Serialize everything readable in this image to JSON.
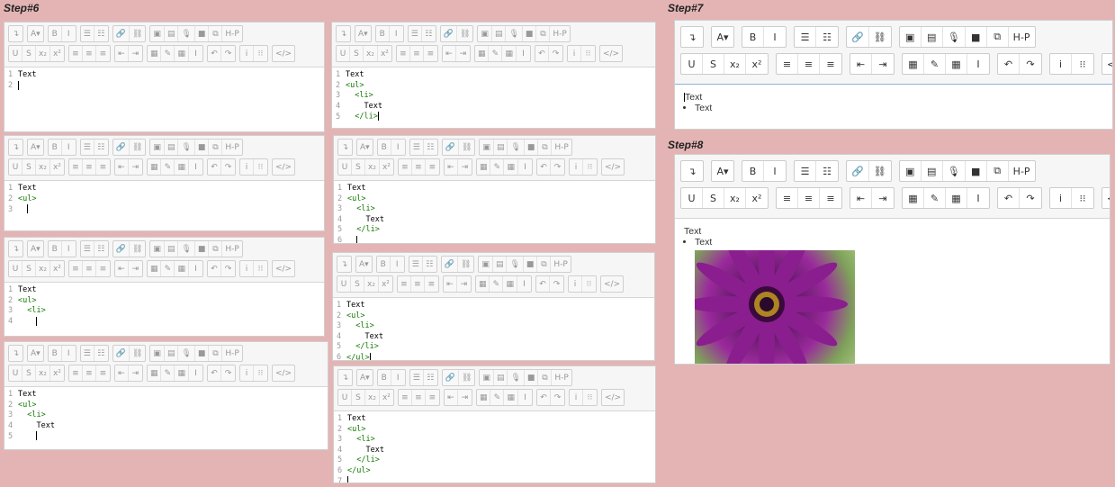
{
  "labels": {
    "step6": "Step#6",
    "step7": "Step#7",
    "step8": "Step#8"
  },
  "toolbar_icons": {
    "row1": [
      "↴",
      "A▾",
      "B",
      "I",
      "☰",
      "☷",
      "🔗",
      "⛓",
      "▣",
      "▤",
      "🎙",
      "■",
      "⧉",
      "H-P"
    ],
    "row2": [
      "U",
      "S",
      "x₂",
      "x²",
      "≡",
      "≡",
      "≡",
      "⇤",
      "⇥",
      "▦",
      "✎",
      "▦",
      "I",
      "↶",
      "↷",
      "i",
      "⁝⁝",
      "</>"
    ]
  },
  "small_editors": [
    {
      "lines": [
        {
          "n": "1",
          "t": "Text",
          "k": "txt"
        },
        {
          "n": "2",
          "t": "",
          "k": "cur"
        }
      ]
    },
    {
      "lines": [
        {
          "n": "1",
          "t": "Text",
          "k": "txt"
        },
        {
          "n": "2",
          "t": "<ul>",
          "k": "tag"
        },
        {
          "n": "3",
          "t": "  ",
          "k": "cur"
        }
      ]
    },
    {
      "lines": [
        {
          "n": "1",
          "t": "Text",
          "k": "txt"
        },
        {
          "n": "2",
          "t": "<ul>",
          "k": "tag"
        },
        {
          "n": "3",
          "t": "  <li>",
          "k": "tag"
        },
        {
          "n": "4",
          "t": "    ",
          "k": "cur"
        }
      ]
    },
    {
      "lines": [
        {
          "n": "1",
          "t": "Text",
          "k": "txt"
        },
        {
          "n": "2",
          "t": "<ul>",
          "k": "tag"
        },
        {
          "n": "3",
          "t": "  <li>",
          "k": "tag"
        },
        {
          "n": "4",
          "t": "    Text",
          "k": "txt"
        },
        {
          "n": "5",
          "t": "    ",
          "k": "cur"
        }
      ]
    },
    {
      "lines": [
        {
          "n": "1",
          "t": "Text",
          "k": "txt"
        },
        {
          "n": "2",
          "t": "<ul>",
          "k": "tag"
        },
        {
          "n": "3",
          "t": "  <li>",
          "k": "tag"
        },
        {
          "n": "4",
          "t": "    Text",
          "k": "txt"
        },
        {
          "n": "5",
          "t": "  </li>",
          "k": "tagcur"
        }
      ]
    },
    {
      "lines": [
        {
          "n": "1",
          "t": "Text",
          "k": "txt"
        },
        {
          "n": "2",
          "t": "<ul>",
          "k": "tag"
        },
        {
          "n": "3",
          "t": "  <li>",
          "k": "tag"
        },
        {
          "n": "4",
          "t": "    Text",
          "k": "txt"
        },
        {
          "n": "5",
          "t": "  </li>",
          "k": "tag"
        },
        {
          "n": "6",
          "t": "  ",
          "k": "cur"
        }
      ]
    },
    {
      "lines": [
        {
          "n": "1",
          "t": "Text",
          "k": "txt"
        },
        {
          "n": "2",
          "t": "<ul>",
          "k": "tag"
        },
        {
          "n": "3",
          "t": "  <li>",
          "k": "tag"
        },
        {
          "n": "4",
          "t": "    Text",
          "k": "txt"
        },
        {
          "n": "5",
          "t": "  </li>",
          "k": "tag"
        },
        {
          "n": "6",
          "t": "</ul>",
          "k": "tagcur"
        }
      ]
    },
    {
      "lines": [
        {
          "n": "1",
          "t": "Text",
          "k": "txt"
        },
        {
          "n": "2",
          "t": "<ul>",
          "k": "tag"
        },
        {
          "n": "3",
          "t": "  <li>",
          "k": "tag"
        },
        {
          "n": "4",
          "t": "    Text",
          "k": "txt"
        },
        {
          "n": "5",
          "t": "  </li>",
          "k": "tag"
        },
        {
          "n": "6",
          "t": "</ul>",
          "k": "tag"
        },
        {
          "n": "7",
          "t": "",
          "k": "cur"
        }
      ]
    }
  ],
  "step7": {
    "line1": "Text",
    "bullet": "Text"
  },
  "step8": {
    "line1": "Text",
    "bullet": "Text"
  }
}
